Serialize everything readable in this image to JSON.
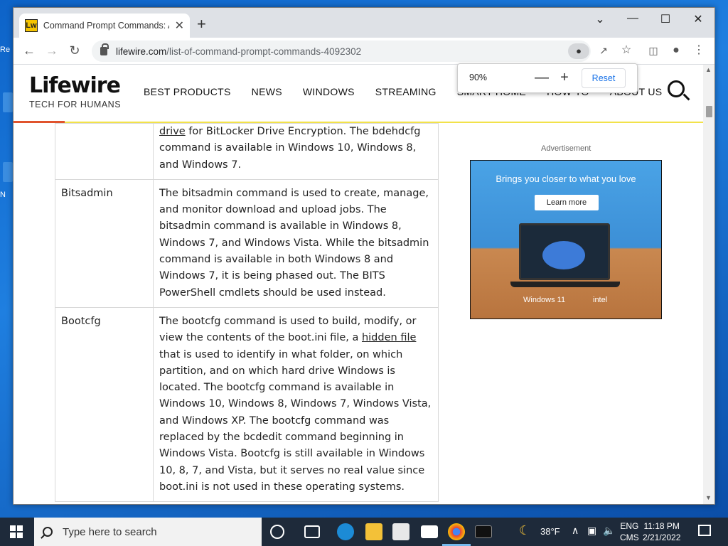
{
  "desktop": {
    "left_fragments": [
      "Re",
      "N"
    ]
  },
  "browser": {
    "tab": {
      "favicon": "Lw",
      "title": "Command Prompt Commands: A",
      "close_glyph": "✕"
    },
    "new_tab_glyph": "+",
    "window_controls": {
      "dropdown": "⌄",
      "minimize": "—",
      "maximize": "☐",
      "close": "✕"
    },
    "nav": {
      "back": "←",
      "forward": "→",
      "reload": "↻"
    },
    "address": {
      "host": "lifewire.com",
      "path": "/list-of-command-prompt-commands-4092302"
    },
    "toolbar_icons": [
      "zoom-icon",
      "share-icon",
      "star-icon",
      "side-panel-icon",
      "profile-icon",
      "menu-icon"
    ],
    "zoom_popup": {
      "value": "90%",
      "minus": "—",
      "plus": "+",
      "reset_label": "Reset"
    }
  },
  "site": {
    "logo": "Lifewire",
    "tagline": "TECH FOR HUMANS",
    "nav_items": [
      "BEST PRODUCTS",
      "NEWS",
      "WINDOWS",
      "STREAMING",
      "SMART HOME",
      "HOW-TO",
      "ABOUT US"
    ],
    "accent_colors": {
      "orange": "#e0532d",
      "yellow": "#f2e24a"
    }
  },
  "table": {
    "row0": {
      "link": "drive",
      "text": " for BitLocker Drive Encryption. The bdehdcfg command is available in Windows 10, Windows 8, and Windows 7."
    },
    "row1": {
      "command": "Bitsadmin",
      "text": "The bitsadmin command is used to create, manage, and monitor download and upload jobs. The bitsadmin command is available in Windows 8, Windows 7, and Windows Vista. While the bitsadmin command is available in both Windows 8 and Windows 7, it is being phased out. The BITS PowerShell cmdlets should be used instead."
    },
    "row2": {
      "command": "Bootcfg",
      "text_before": "The bootcfg command is used to build, modify, or view the contents of the boot.ini file, a ",
      "link": "hidden file",
      "text_after": " that is used to identify in what folder, on which partition, and on which hard drive Windows is located. The bootcfg command is available in Windows 10, Windows 8, Windows 7, Windows Vista, and Windows XP. The bootcfg command was replaced by the bcdedit command beginning in Windows Vista. Bootcfg is still available in Windows 10, 8, 7, and Vista, but it serves no real value since boot.ini is not used in these operating systems."
    }
  },
  "ad": {
    "label": "Advertisement",
    "headline": "Brings you closer to what you love",
    "button": "Learn more",
    "brand1": "Windows 11",
    "brand2": "intel"
  },
  "taskbar": {
    "search_placeholder": "Type here to search",
    "weather": "38°F",
    "lang_line1": "ENG",
    "lang_line2": "CMS",
    "time": "11:18 PM",
    "date": "2/21/2022",
    "tray_up": "∧"
  }
}
